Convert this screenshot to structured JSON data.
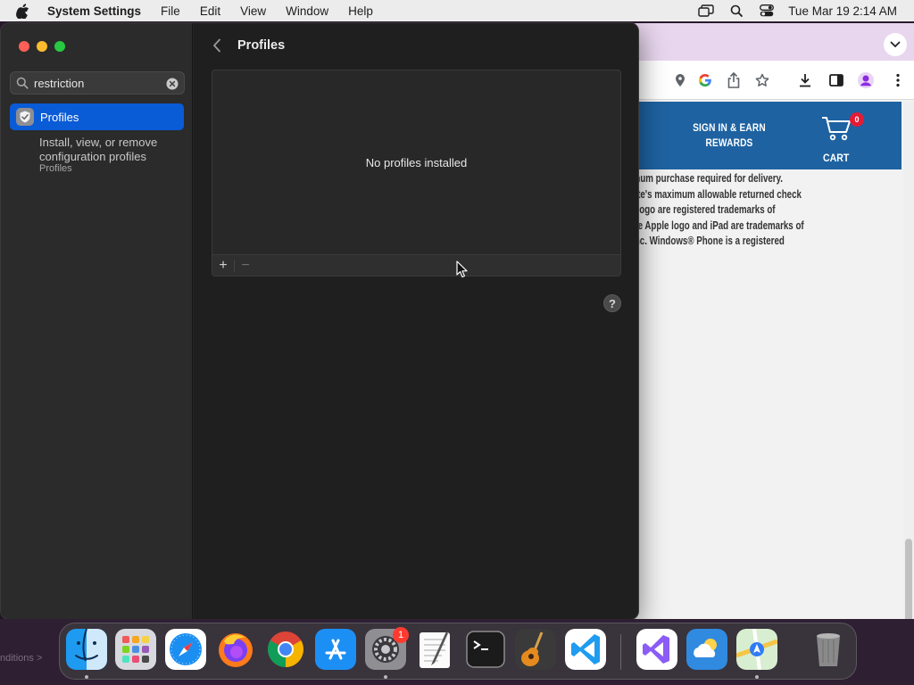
{
  "menubar": {
    "app_name": "System Settings",
    "menus": [
      "File",
      "Edit",
      "View",
      "Window",
      "Help"
    ],
    "clock": "Tue Mar 19  2:14 AM"
  },
  "settings": {
    "search": {
      "value": "restriction",
      "placeholder": "Search"
    },
    "sidebar_result": {
      "label": "Profiles",
      "description": "Install, view, or remove configuration profiles",
      "sub_label": "Profiles"
    },
    "page_title": "Profiles",
    "profiles_panel": {
      "empty_text": "No profiles installed",
      "add_label": "+",
      "remove_label": "−"
    },
    "help_label": "?"
  },
  "browser": {
    "sign_in_label": "SIGN IN & EARN REWARDS",
    "cart_label": "CART",
    "cart_count": "0",
    "legal_lines": [
      "nimum purchase required for delivery.",
      "state's maximum allowable returned check",
      "ce logo are registered trademarks of",
      ", the Apple logo and iPad are trademarks of",
      "e Inc. Windows® Phone is a registered"
    ]
  },
  "bottom_left_text": "nditions >",
  "dock": {
    "items": [
      "finder-icon",
      "launchpad-icon",
      "safari-icon",
      "firefox-icon",
      "chrome-icon",
      "app-store-icon",
      "system-settings-icon",
      "textedit-icon",
      "terminal-icon",
      "garageband-icon",
      "vscode-icon",
      "visual-studio-icon",
      "weather-icon",
      "maps-icon",
      "trash-icon"
    ],
    "settings_badge": "1"
  },
  "colors": {
    "accent": "#0a5bd6",
    "site_header": "#1e62a1",
    "cart_badge": "#e21b36"
  }
}
